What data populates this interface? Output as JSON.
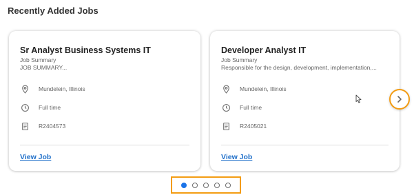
{
  "section_title": "Recently Added Jobs",
  "jobs": [
    {
      "title": "Sr Analyst Business Systems IT",
      "summary_label": "Job Summary",
      "summary": "JOB SUMMARY...",
      "location": "Mundelein, Illinois",
      "time_type": "Full time",
      "req_id": "R2404573",
      "link_label": "View Job"
    },
    {
      "title": "Developer Analyst IT",
      "summary_label": "Job Summary",
      "summary": "Responsible for the design, development, implementation,...",
      "location": "Mundelein, Illinois",
      "time_type": "Full time",
      "req_id": "R2405021",
      "link_label": "View Job"
    }
  ],
  "pagination": {
    "total_pages": 5,
    "active_page": 1
  },
  "colors": {
    "highlight": "#f39c12",
    "link": "#1f6fc9",
    "active_dot": "#1a73e8"
  },
  "icons": [
    "location-pin-icon",
    "clock-icon",
    "document-icon",
    "chevron-right-icon",
    "mouse-cursor-icon"
  ]
}
